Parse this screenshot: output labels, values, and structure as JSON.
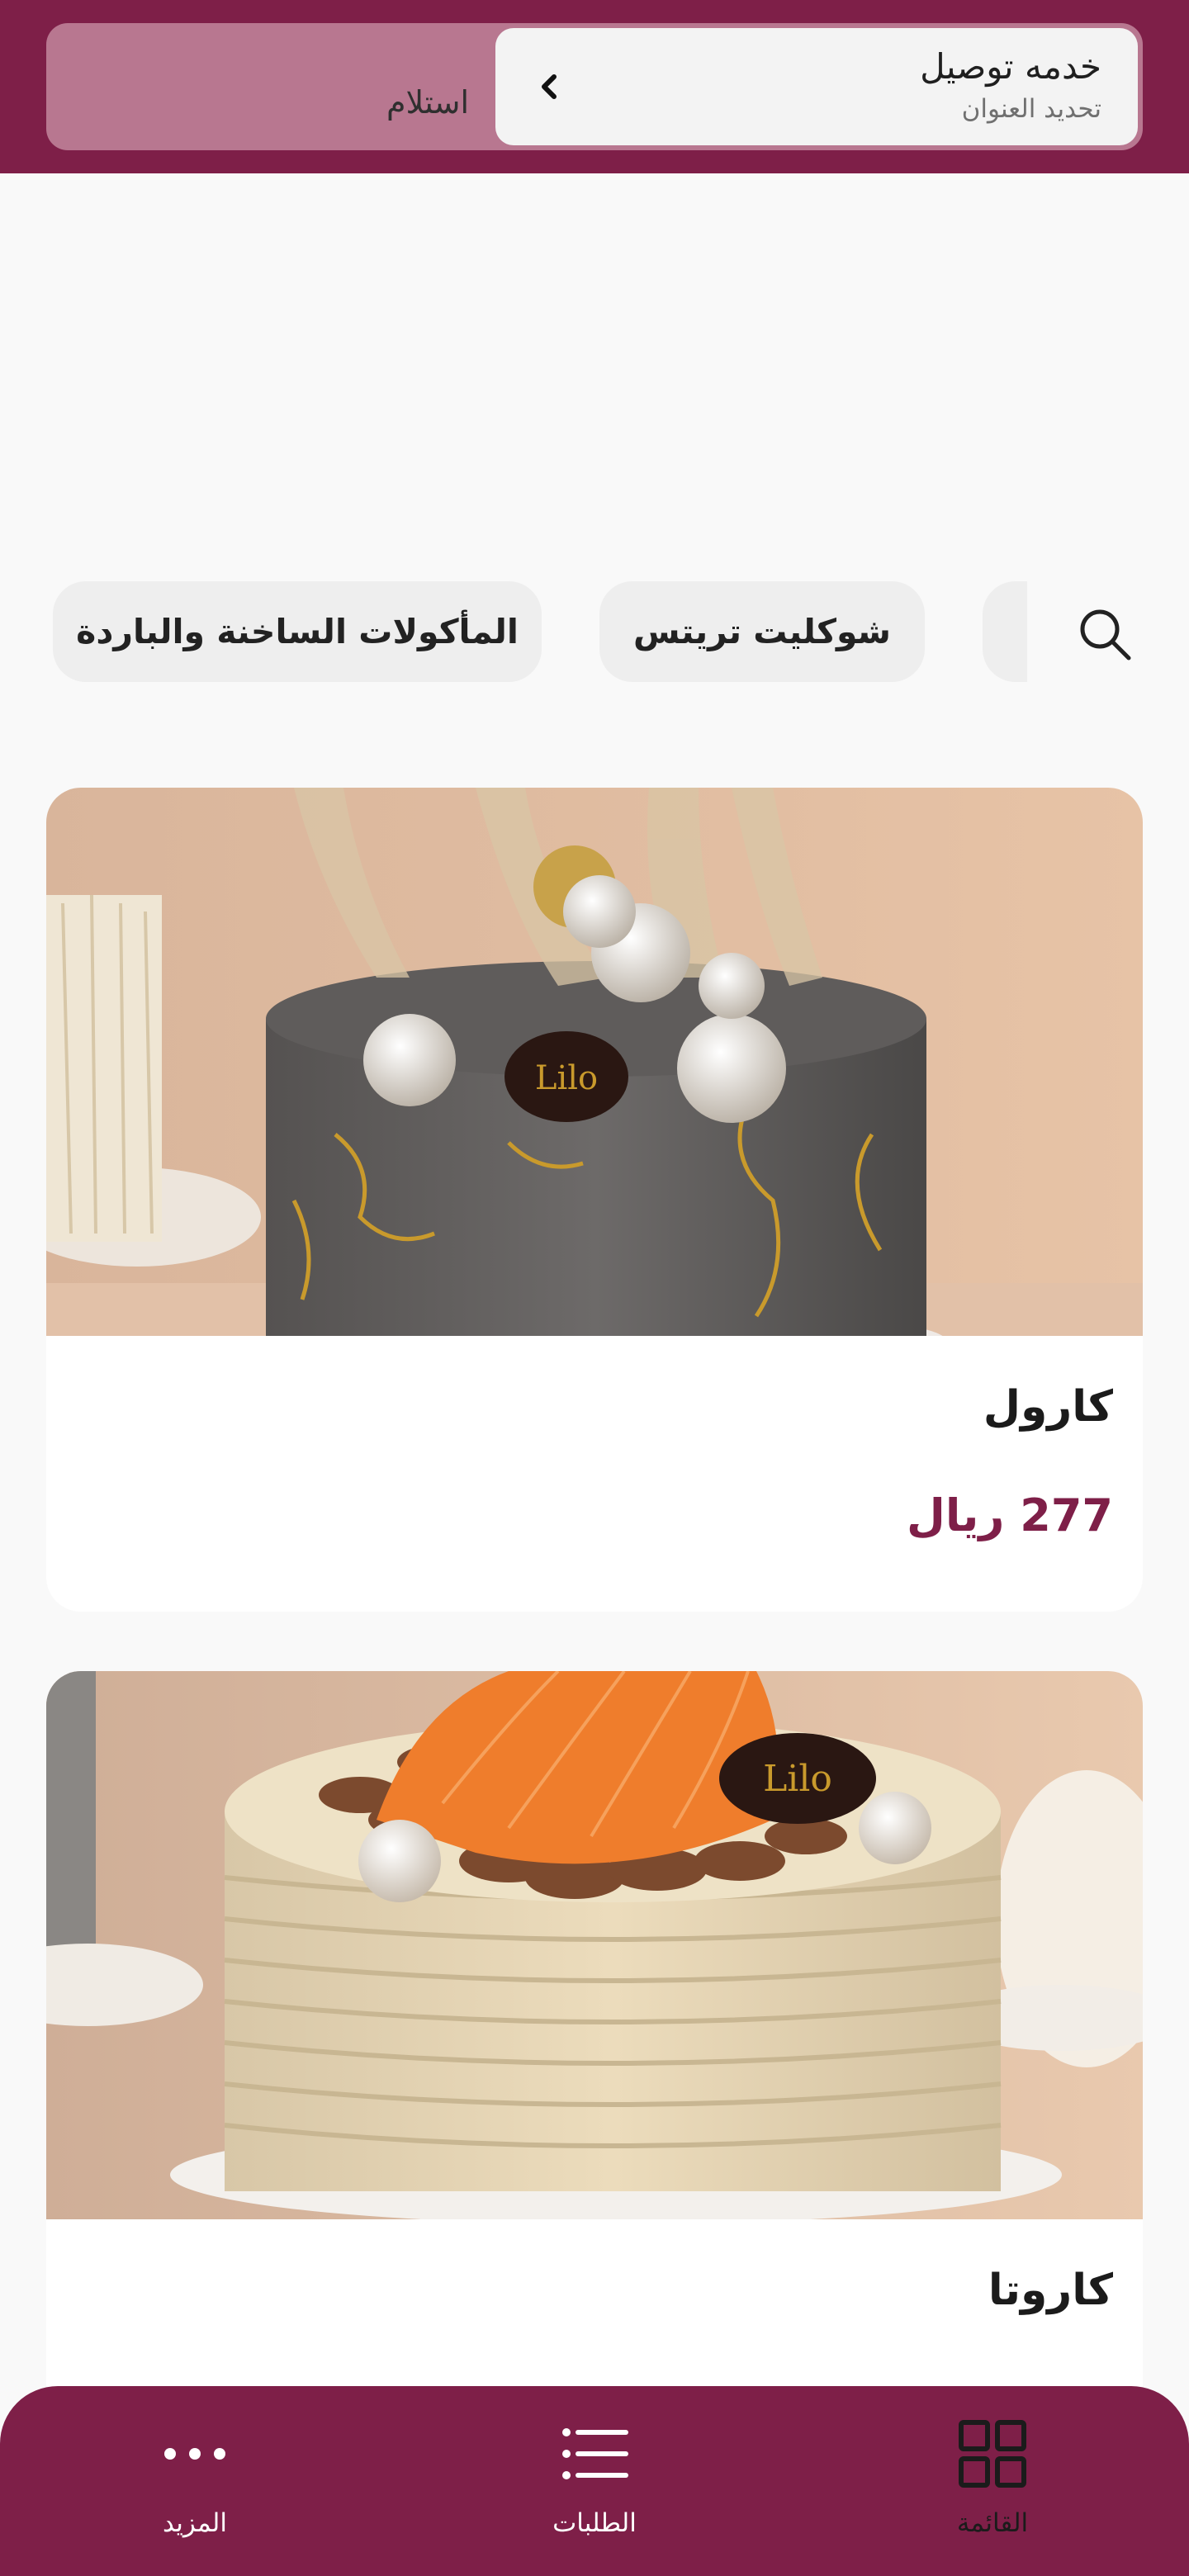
{
  "header": {
    "delivery_title": "خدمه توصيل",
    "delivery_subtitle": "تحديد العنوان",
    "pickup_label": "استلام"
  },
  "categories": [
    "المأكولات الساخنة والباردة",
    "شوكليت تريتس"
  ],
  "products": [
    {
      "name": "كارول",
      "price": "277 ريال"
    },
    {
      "name": "كاروتا",
      "price": ""
    }
  ],
  "nav": {
    "menu_label": "القائمة",
    "orders_label": "الطلبات",
    "more_label": "المزيد"
  },
  "colors": {
    "brand": "#7e1f48",
    "brand_light": "#b87790",
    "background": "#f9f9f9"
  },
  "icons": {
    "search": "search-icon",
    "chevron": "chevron-left-icon",
    "menu": "grid-icon",
    "orders": "list-icon",
    "more": "more-dots-icon"
  }
}
